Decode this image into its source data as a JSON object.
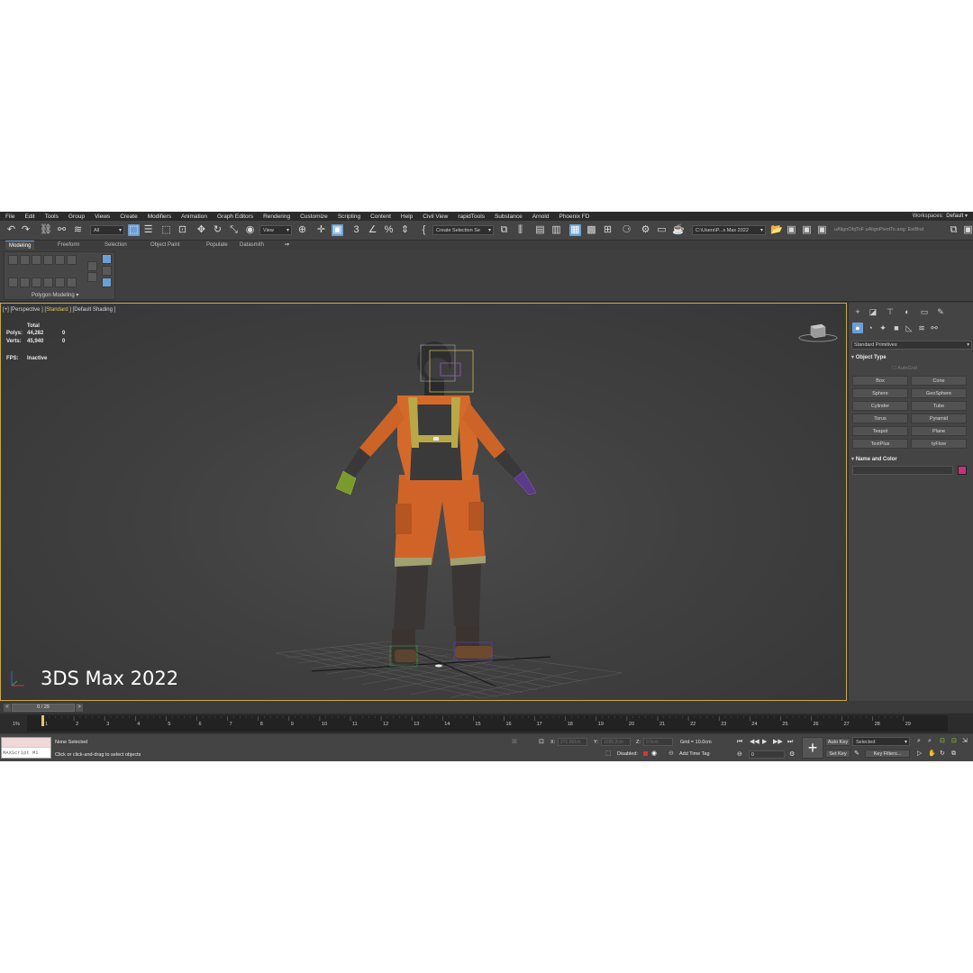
{
  "menu": {
    "items": [
      "File",
      "Edit",
      "Tools",
      "Group",
      "Views",
      "Create",
      "Modifiers",
      "Animation",
      "Graph Editors",
      "Rendering",
      "Customize",
      "Scripting",
      "Content",
      "Help",
      "Civil View",
      "rapidTools",
      "Substance",
      "Arnold",
      "Phoenix FD"
    ],
    "workspaces_label": "Workspaces:",
    "workspace_value": "Default"
  },
  "toolbar": {
    "filter_value": "All",
    "refcoord_value": "View",
    "selection_set_value": "Create Selection Se",
    "project_path_value": "C:\\Users\\P...s Max 2022",
    "script_text": "uAlignObjToF uAlignPivotTo ang: ExtBnd"
  },
  "ribbon": {
    "tabs": [
      "Modeling",
      "Freeform",
      "Selection",
      "Object Paint",
      "Populate",
      "Datasmith"
    ],
    "panel_label": "Polygon Modeling ▾"
  },
  "viewport": {
    "label_prefix": "[+] [Perspective ] [",
    "label_standard": "Standard",
    "label_suffix": " ] [Default Shading ]",
    "stats_total_header": "Total",
    "polys_label": "Polys:",
    "polys_total": "44,282",
    "polys_sel": "0",
    "verts_label": "Verts:",
    "verts_total": "45,940",
    "verts_sel": "0",
    "fps_label": "FPS:",
    "fps_value": "Inactive",
    "watermark": "3DS Max 2022"
  },
  "command_panel": {
    "category_value": "Standard Primitives",
    "object_type_title": "Object Type",
    "autogrid_label": "AutoGrid",
    "primitives": [
      "Box",
      "Cone",
      "Sphere",
      "GeoSphere",
      "Cylinder",
      "Tube",
      "Torus",
      "Pyramid",
      "Teapot",
      "Plane",
      "TextPlus",
      "tyFlow"
    ],
    "name_color_title": "Name and Color",
    "object_color": "#c8327a"
  },
  "timeline": {
    "frame_display": "0 / 29",
    "ticks": [
      "1%",
      "1",
      "2",
      "3",
      "4",
      "5",
      "6",
      "7",
      "8",
      "9",
      "10",
      "11",
      "12",
      "13",
      "14",
      "15",
      "16",
      "17",
      "18",
      "19",
      "20",
      "21",
      "22",
      "23",
      "24",
      "25",
      "26",
      "27",
      "28",
      "29"
    ]
  },
  "status": {
    "maxscript_text": "MAXScript Mi",
    "selection_status": "None Selected",
    "prompt": "Click or click-and-drag to select objects",
    "x_label": "X:",
    "x_value": "271.561m",
    "y_label": "Y:",
    "y_value": "1035.2cm",
    "z_label": "Z:",
    "z_value": "0.0cm",
    "grid": "Grid = 10.0cm",
    "disabled_label": "Disabled:",
    "add_time_tag": "Add Time Tag",
    "auto_key": "Auto Key",
    "set_key": "Set Key",
    "key_mode_value": "Selected",
    "key_filters": "Key Filters...",
    "current_frame": "0"
  }
}
